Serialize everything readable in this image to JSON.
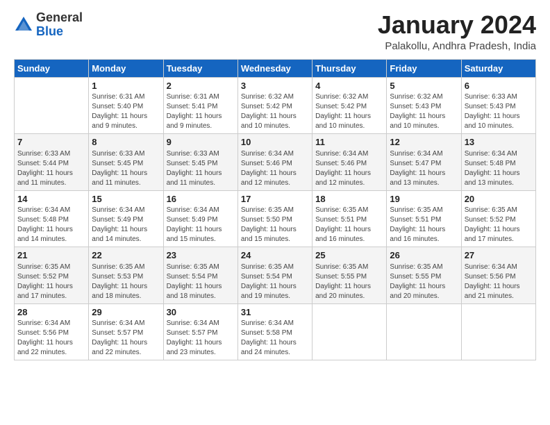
{
  "logo": {
    "general": "General",
    "blue": "Blue"
  },
  "title": "January 2024",
  "location": "Palakollu, Andhra Pradesh, India",
  "days_header": [
    "Sunday",
    "Monday",
    "Tuesday",
    "Wednesday",
    "Thursday",
    "Friday",
    "Saturday"
  ],
  "weeks": [
    [
      {
        "day": "",
        "info": ""
      },
      {
        "day": "1",
        "info": "Sunrise: 6:31 AM\nSunset: 5:40 PM\nDaylight: 11 hours\nand 9 minutes."
      },
      {
        "day": "2",
        "info": "Sunrise: 6:31 AM\nSunset: 5:41 PM\nDaylight: 11 hours\nand 9 minutes."
      },
      {
        "day": "3",
        "info": "Sunrise: 6:32 AM\nSunset: 5:42 PM\nDaylight: 11 hours\nand 10 minutes."
      },
      {
        "day": "4",
        "info": "Sunrise: 6:32 AM\nSunset: 5:42 PM\nDaylight: 11 hours\nand 10 minutes."
      },
      {
        "day": "5",
        "info": "Sunrise: 6:32 AM\nSunset: 5:43 PM\nDaylight: 11 hours\nand 10 minutes."
      },
      {
        "day": "6",
        "info": "Sunrise: 6:33 AM\nSunset: 5:43 PM\nDaylight: 11 hours\nand 10 minutes."
      }
    ],
    [
      {
        "day": "7",
        "info": "Sunrise: 6:33 AM\nSunset: 5:44 PM\nDaylight: 11 hours\nand 11 minutes."
      },
      {
        "day": "8",
        "info": "Sunrise: 6:33 AM\nSunset: 5:45 PM\nDaylight: 11 hours\nand 11 minutes."
      },
      {
        "day": "9",
        "info": "Sunrise: 6:33 AM\nSunset: 5:45 PM\nDaylight: 11 hours\nand 11 minutes."
      },
      {
        "day": "10",
        "info": "Sunrise: 6:34 AM\nSunset: 5:46 PM\nDaylight: 11 hours\nand 12 minutes."
      },
      {
        "day": "11",
        "info": "Sunrise: 6:34 AM\nSunset: 5:46 PM\nDaylight: 11 hours\nand 12 minutes."
      },
      {
        "day": "12",
        "info": "Sunrise: 6:34 AM\nSunset: 5:47 PM\nDaylight: 11 hours\nand 13 minutes."
      },
      {
        "day": "13",
        "info": "Sunrise: 6:34 AM\nSunset: 5:48 PM\nDaylight: 11 hours\nand 13 minutes."
      }
    ],
    [
      {
        "day": "14",
        "info": "Sunrise: 6:34 AM\nSunset: 5:48 PM\nDaylight: 11 hours\nand 14 minutes."
      },
      {
        "day": "15",
        "info": "Sunrise: 6:34 AM\nSunset: 5:49 PM\nDaylight: 11 hours\nand 14 minutes."
      },
      {
        "day": "16",
        "info": "Sunrise: 6:34 AM\nSunset: 5:49 PM\nDaylight: 11 hours\nand 15 minutes."
      },
      {
        "day": "17",
        "info": "Sunrise: 6:35 AM\nSunset: 5:50 PM\nDaylight: 11 hours\nand 15 minutes."
      },
      {
        "day": "18",
        "info": "Sunrise: 6:35 AM\nSunset: 5:51 PM\nDaylight: 11 hours\nand 16 minutes."
      },
      {
        "day": "19",
        "info": "Sunrise: 6:35 AM\nSunset: 5:51 PM\nDaylight: 11 hours\nand 16 minutes."
      },
      {
        "day": "20",
        "info": "Sunrise: 6:35 AM\nSunset: 5:52 PM\nDaylight: 11 hours\nand 17 minutes."
      }
    ],
    [
      {
        "day": "21",
        "info": "Sunrise: 6:35 AM\nSunset: 5:52 PM\nDaylight: 11 hours\nand 17 minutes."
      },
      {
        "day": "22",
        "info": "Sunrise: 6:35 AM\nSunset: 5:53 PM\nDaylight: 11 hours\nand 18 minutes."
      },
      {
        "day": "23",
        "info": "Sunrise: 6:35 AM\nSunset: 5:54 PM\nDaylight: 11 hours\nand 18 minutes."
      },
      {
        "day": "24",
        "info": "Sunrise: 6:35 AM\nSunset: 5:54 PM\nDaylight: 11 hours\nand 19 minutes."
      },
      {
        "day": "25",
        "info": "Sunrise: 6:35 AM\nSunset: 5:55 PM\nDaylight: 11 hours\nand 20 minutes."
      },
      {
        "day": "26",
        "info": "Sunrise: 6:35 AM\nSunset: 5:55 PM\nDaylight: 11 hours\nand 20 minutes."
      },
      {
        "day": "27",
        "info": "Sunrise: 6:34 AM\nSunset: 5:56 PM\nDaylight: 11 hours\nand 21 minutes."
      }
    ],
    [
      {
        "day": "28",
        "info": "Sunrise: 6:34 AM\nSunset: 5:56 PM\nDaylight: 11 hours\nand 22 minutes."
      },
      {
        "day": "29",
        "info": "Sunrise: 6:34 AM\nSunset: 5:57 PM\nDaylight: 11 hours\nand 22 minutes."
      },
      {
        "day": "30",
        "info": "Sunrise: 6:34 AM\nSunset: 5:57 PM\nDaylight: 11 hours\nand 23 minutes."
      },
      {
        "day": "31",
        "info": "Sunrise: 6:34 AM\nSunset: 5:58 PM\nDaylight: 11 hours\nand 24 minutes."
      },
      {
        "day": "",
        "info": ""
      },
      {
        "day": "",
        "info": ""
      },
      {
        "day": "",
        "info": ""
      }
    ]
  ]
}
